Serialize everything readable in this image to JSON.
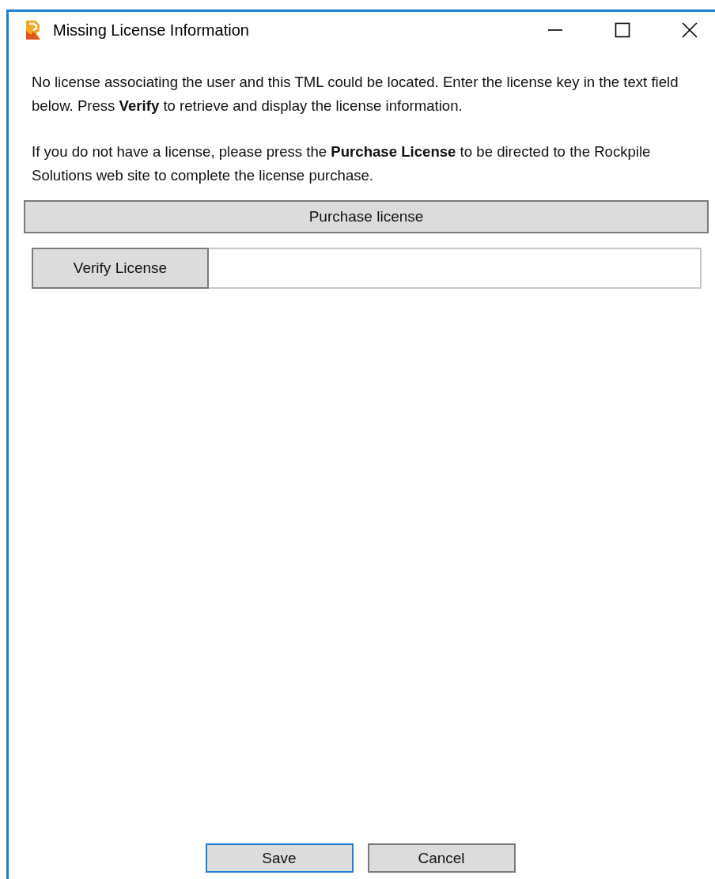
{
  "window": {
    "title": "Missing License Information"
  },
  "paragraphs": [
    "No license associating the user and this TML could be located. Enter the license key in the text field below. Press **Verify** to retrieve and display the license information.",
    "If you do not have a license, please press the **Purchase License** to be directed to the Rockpile Solutions web site to complete the license purchase."
  ],
  "purchase_button": "Purchase license",
  "verify": {
    "button": "Verify License"
  },
  "buttons": [
    {
      "label": "Save",
      "focused": true
    },
    {
      "label": "Cancel",
      "focused": false
    }
  ]
}
